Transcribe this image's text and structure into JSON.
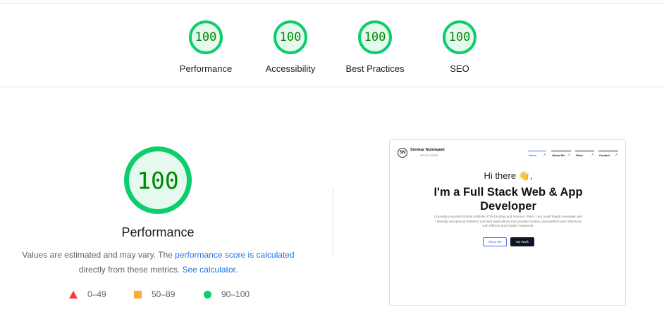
{
  "scores": [
    {
      "value": "100",
      "label": "Performance"
    },
    {
      "value": "100",
      "label": "Accessibility"
    },
    {
      "value": "100",
      "label": "Best Practices"
    },
    {
      "value": "100",
      "label": "SEO"
    }
  ],
  "main": {
    "score": "100",
    "title": "Performance",
    "desc_prefix": "Values are estimated and may vary. The ",
    "desc_link": "performance score is calculated",
    "desc_middle": "directly from these metrics. ",
    "desc_calc_link": "See calculator",
    "desc_end": "."
  },
  "legend": [
    {
      "range": "0–49",
      "shape": "triangle",
      "color": "#ff3333"
    },
    {
      "range": "50–89",
      "shape": "square",
      "color": "#ffaa33"
    },
    {
      "range": "90–100",
      "shape": "circle",
      "color": "#0cce6b"
    }
  ],
  "colors": {
    "pass": "#0cce6b",
    "pass_text": "#008800",
    "link": "#1a73e8"
  },
  "screenshot": {
    "logo_initials": "SN",
    "brand_name": "Sreekar Nutulapati",
    "brand_role": "DEVELOPER",
    "nav": [
      {
        "label": "Home",
        "arrow": "↗"
      },
      {
        "label": "About Me",
        "arrow": "↗"
      },
      {
        "label": "Work",
        "arrow": "↗"
      },
      {
        "label": "Contact",
        "arrow": "↗"
      }
    ],
    "greeting": "Hi there 👋,",
    "headline": "I'm a Full Stack Web & App Developer",
    "paragraph": "Currently a student at Birla Institute of Technology and Science, Pilani. I am a self taught developer and I develop exceptional websites and web applications that provide intuitive, pixel-perfect user interfaces with efficient and modern backends.",
    "btn_about": "About Me",
    "btn_work": "My Work"
  }
}
